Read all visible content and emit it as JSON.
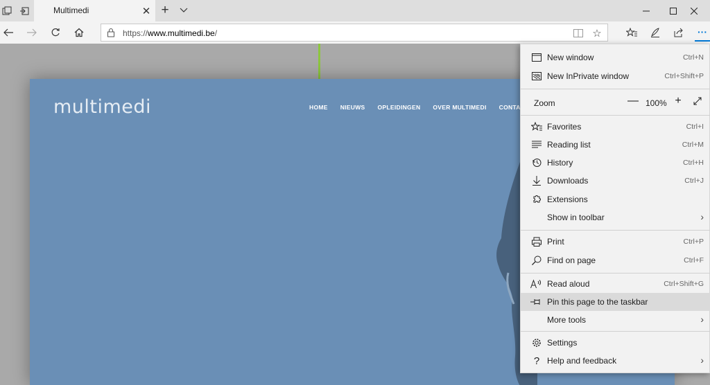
{
  "tab": {
    "title": "Multimedi"
  },
  "address": {
    "scheme": "https://",
    "host": "www.multimedi.be",
    "path": "/"
  },
  "site": {
    "logo": "multimedi",
    "nav": [
      "HOME",
      "NIEUWS",
      "OPLEIDINGEN",
      "OVER MULTIMEDI",
      "CONTAC"
    ]
  },
  "menu": {
    "items": [
      {
        "label": "New window",
        "shortcut": "Ctrl+N",
        "icon": "window-icon"
      },
      {
        "label": "New InPrivate window",
        "shortcut": "Ctrl+Shift+P",
        "icon": "inprivate-icon"
      },
      {
        "label": "Favorites",
        "shortcut": "Ctrl+I",
        "icon": "favorites-icon"
      },
      {
        "label": "Reading list",
        "shortcut": "Ctrl+M",
        "icon": "reading-list-icon"
      },
      {
        "label": "History",
        "shortcut": "Ctrl+H",
        "icon": "history-icon"
      },
      {
        "label": "Downloads",
        "shortcut": "Ctrl+J",
        "icon": "download-icon"
      },
      {
        "label": "Extensions",
        "shortcut": "",
        "icon": "extensions-icon"
      },
      {
        "label": "Show in toolbar",
        "shortcut": "",
        "icon": ""
      },
      {
        "label": "Print",
        "shortcut": "Ctrl+P",
        "icon": "print-icon"
      },
      {
        "label": "Find on page",
        "shortcut": "Ctrl+F",
        "icon": "search-icon"
      },
      {
        "label": "Read aloud",
        "shortcut": "Ctrl+Shift+G",
        "icon": "read-aloud-icon"
      },
      {
        "label": "Pin this page to the taskbar",
        "shortcut": "",
        "icon": "pin-icon"
      },
      {
        "label": "More tools",
        "shortcut": "",
        "icon": ""
      },
      {
        "label": "Settings",
        "shortcut": "",
        "icon": "gear-icon"
      },
      {
        "label": "Help and feedback",
        "shortcut": "",
        "icon": "help-icon"
      }
    ],
    "zoom": {
      "label": "Zoom",
      "value": "100%"
    }
  },
  "colors": {
    "accent": "#0078d7",
    "brand_green": "#8dc63f",
    "hero_blue": "#6a8fb6"
  }
}
